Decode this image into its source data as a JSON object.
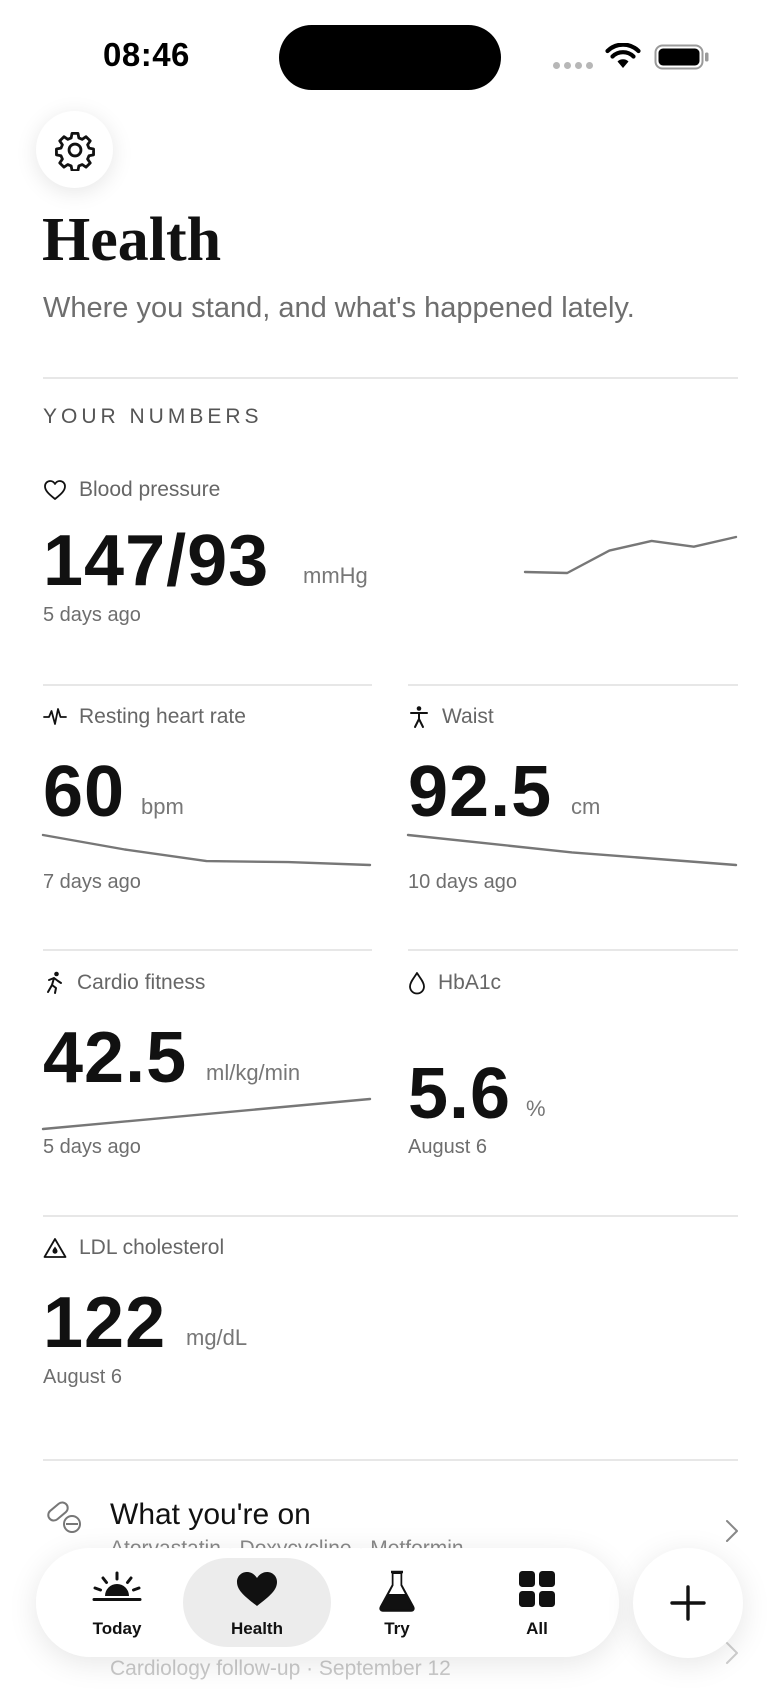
{
  "status_bar": {
    "time": "08:46"
  },
  "header": {
    "title": "Health",
    "subtitle": "Where you stand, and what's happened lately."
  },
  "section": {
    "label": "YOUR NUMBERS"
  },
  "metrics": {
    "blood_pressure": {
      "label": "Blood pressure",
      "value": "147/93",
      "unit": "mmHg",
      "date": "5 days ago",
      "trend": [
        36,
        37,
        14,
        4,
        10,
        0
      ]
    },
    "heart_rate": {
      "label": "Resting heart rate",
      "value": "60",
      "unit": "bpm",
      "date": "7 days ago",
      "trend": [
        0,
        15,
        27,
        28,
        31
      ]
    },
    "waist": {
      "label": "Waist",
      "value": "92.5",
      "unit": "cm",
      "date": "10 days ago",
      "trend": [
        0,
        18,
        31
      ]
    },
    "cardio": {
      "label": "Cardio fitness",
      "value": "42.5",
      "unit": "ml/kg/min",
      "date": "5 days ago",
      "trend": [
        31,
        0
      ]
    },
    "hba1c": {
      "label": "HbA1c",
      "value": "5.6",
      "unit": "%",
      "date": "August 6"
    },
    "ldl": {
      "label": "LDL cholesterol",
      "value": "122",
      "unit": "mg/dL",
      "date": "August 6"
    }
  },
  "list": {
    "meds": {
      "title": "What you're on",
      "subtitle": "Atorvastatin · Doxycycline · Metformin"
    },
    "visits": {
      "subtitle": "Cardiology follow-up · September 12"
    }
  },
  "tabbar": {
    "tabs": [
      {
        "label": "Today",
        "icon": "sunrise-icon"
      },
      {
        "label": "Health",
        "icon": "heart-icon",
        "active": true
      },
      {
        "label": "Try",
        "icon": "flask-icon"
      },
      {
        "label": "All",
        "icon": "grid-icon"
      }
    ]
  },
  "colors": {
    "text": "#111111",
    "muted": "#6e6e6e",
    "rule": "#e7e7e7",
    "spark": "#777777",
    "active_tab": "#ececec"
  }
}
